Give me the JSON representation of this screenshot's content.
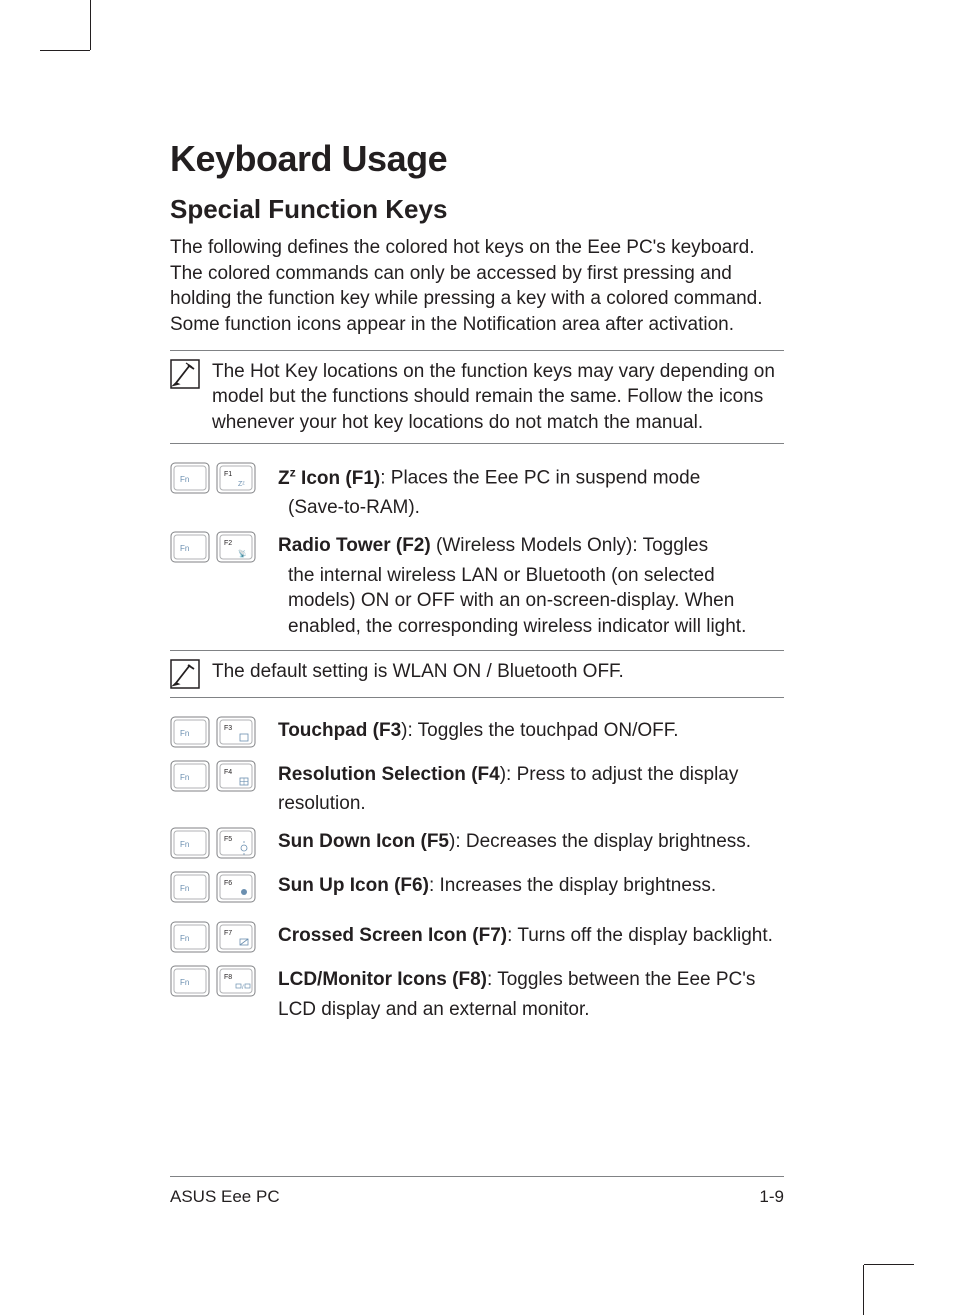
{
  "heading": "Keyboard Usage",
  "subheading": "Special Function Keys",
  "intro": "The following defines the colored hot keys on the Eee PC's keyboard. The colored commands can only be accessed by first pressing and holding the function key while pressing a key with a colored command. Some function icons appear in the Notification area after activation.",
  "note1": "The Hot Key locations on the function keys may vary depending on model but the functions should remain the same. Follow the icons whenever your hot key locations do not match the manual.",
  "note2": "The default setting is WLAN ON / Bluetooth OFF.",
  "fn_label": "Fn",
  "keys": {
    "f1": {
      "label": "F1",
      "sub": "Zᶻ",
      "title_html": "Z<sup>z</sup> Icon (F1)",
      "rest": ": Places the Eee PC in suspend mode",
      "cont": "(Save-to-RAM)."
    },
    "f2": {
      "label": "F2",
      "sub": "📶",
      "title": "Radio Tower (F2)",
      "rest": " (Wireless Models Only): Toggles",
      "cont": "the internal wireless LAN or Bluetooth (on selected models) ON or OFF with an on-screen-display. When enabled, the corresponding wireless indicator will light."
    },
    "f3": {
      "label": "F3",
      "sub": "⬚",
      "title": "Touchpad (F3",
      "rest": "): Toggles the touchpad ON/OFF."
    },
    "f4": {
      "label": "F4",
      "sub": "▦",
      "title": "Resolution Selection (F4",
      "rest": "): Press to adjust the display",
      "cont": "resolution."
    },
    "f5": {
      "label": "F5",
      "sub": "☼↓",
      "title": "Sun Down Icon (F5",
      "rest": "): Decreases the display brightness."
    },
    "f6": {
      "label": "F6",
      "sub": "☼↑",
      "title": "Sun Up Icon (F6)",
      "rest": ": Increases the display brightness."
    },
    "f7": {
      "label": "F7",
      "sub": "⊠",
      "title": "Crossed Screen Icon (F7)",
      "rest": ": Turns off the display backlight."
    },
    "f8": {
      "label": "F8",
      "sub": "▭/▭",
      "title": "LCD/Monitor Icons (F8)",
      "rest": ": Toggles between the Eee PC's",
      "cont": "LCD display and an external monitor."
    }
  },
  "footer_left": "ASUS Eee PC",
  "footer_right": "1-9"
}
